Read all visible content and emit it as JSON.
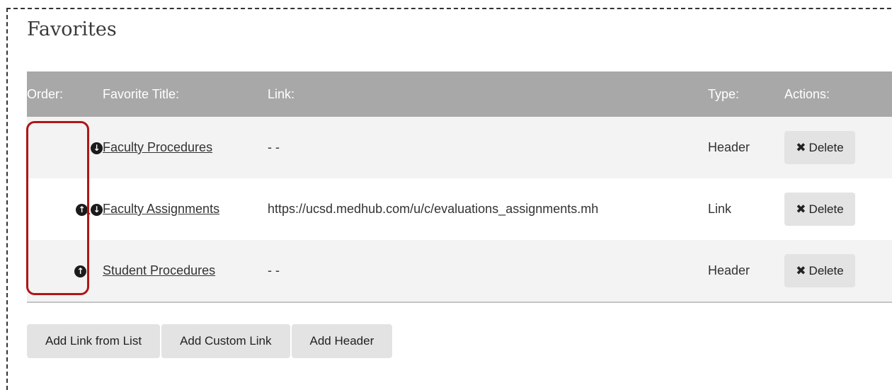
{
  "section": {
    "title": "Favorites"
  },
  "table": {
    "headers": {
      "order": "Order:",
      "title": "Favorite Title:",
      "link": "Link:",
      "type": "Type:",
      "actions": "Actions:"
    },
    "rows": [
      {
        "title": "Faculty Procedures",
        "link": "- -",
        "type": "Header",
        "delete_label": "Delete",
        "order_up": false,
        "order_down": true
      },
      {
        "title": "Faculty Assignments",
        "link": "https://ucsd.medhub.com/u/c/evaluations_assignments.mh",
        "type": "Link",
        "delete_label": "Delete",
        "order_up": true,
        "order_down": true
      },
      {
        "title": "Student Procedures",
        "link": "- -",
        "type": "Header",
        "delete_label": "Delete",
        "order_up": true,
        "order_down": false
      }
    ]
  },
  "buttons": {
    "add_from_list": "Add Link from List",
    "add_custom": "Add Custom Link",
    "add_header": "Add Header"
  },
  "colors": {
    "header_bg": "#a8a8a8",
    "highlight": "#b01616"
  },
  "icons": {
    "up": "arrow-circle-up-icon",
    "down": "arrow-circle-down-icon",
    "delete": "times-icon"
  }
}
